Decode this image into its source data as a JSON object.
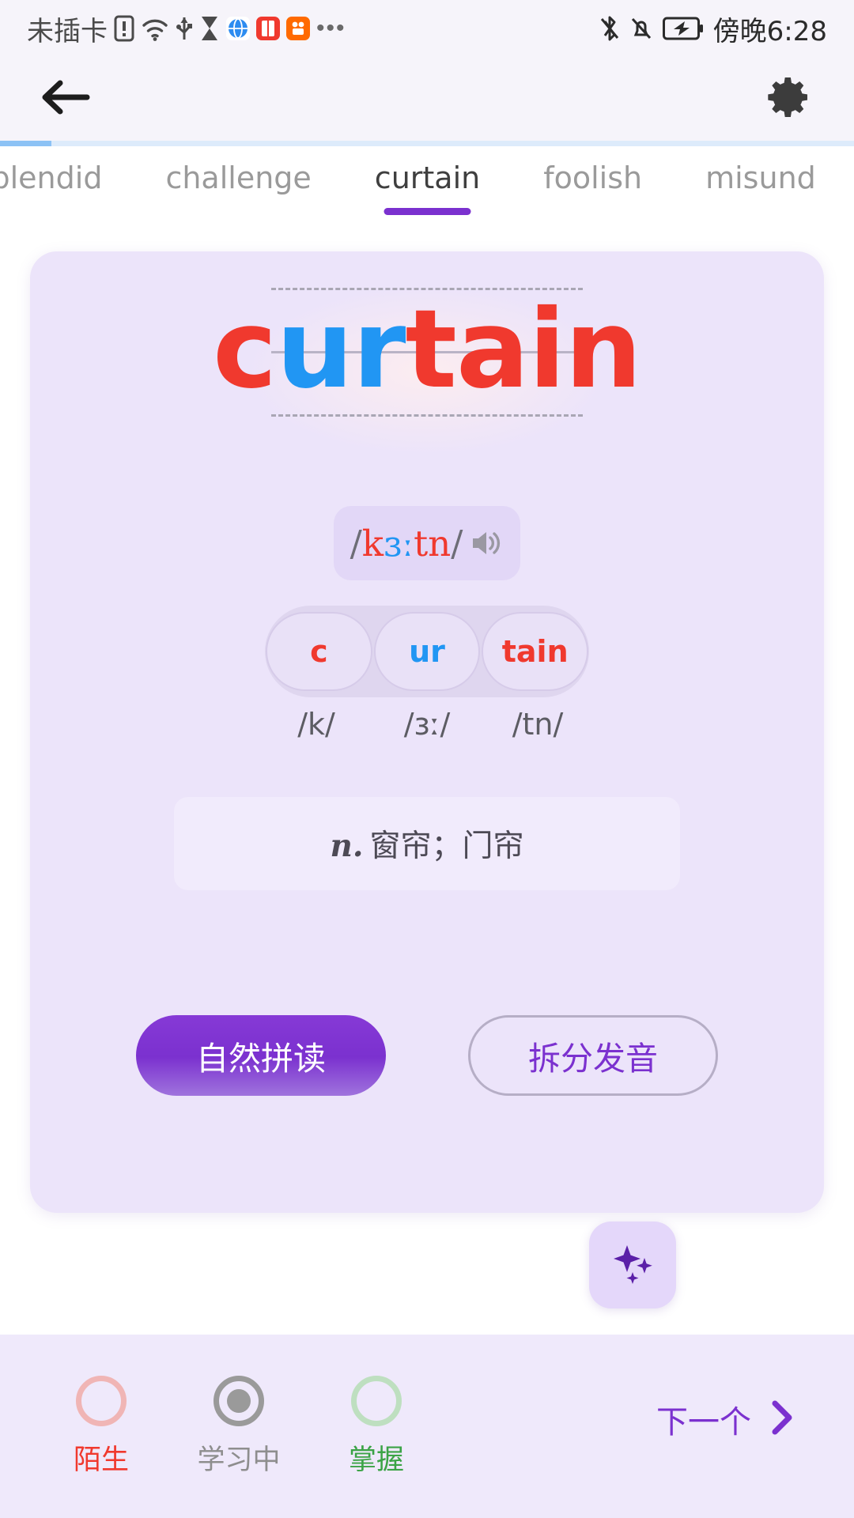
{
  "status_bar": {
    "carrier": "未插卡",
    "time": "傍晚6:28",
    "icons": [
      "sim-alert-icon",
      "wifi-icon",
      "usb-icon",
      "hourglass-icon",
      "globe-app-icon",
      "book-app-icon",
      "orange-app-icon",
      "more-dots-icon"
    ],
    "right_icons": [
      "bluetooth-icon",
      "notification-muted-icon",
      "battery-charging-icon"
    ]
  },
  "app_bar": {
    "back_icon": "arrow-left-icon",
    "settings_icon": "gear-icon"
  },
  "progress": {
    "percent": 6,
    "fill_color": "#8cc2f5",
    "track_color": "#ddebfb"
  },
  "tabs": {
    "active_index": 2,
    "items": [
      {
        "label": "plendid"
      },
      {
        "label": "challenge"
      },
      {
        "label": "curtain"
      },
      {
        "label": "foolish"
      },
      {
        "label": "misunders"
      }
    ]
  },
  "card": {
    "word": {
      "full": "curtain",
      "parts": [
        {
          "text": "c",
          "color": "#f0392e"
        },
        {
          "text": "ur",
          "color": "#2196f3"
        },
        {
          "text": "tain",
          "color": "#f0392e"
        }
      ]
    },
    "phonetic": {
      "open_slash": "/",
      "close_slash": "/",
      "parts": [
        {
          "text": "k",
          "color": "#f0392e"
        },
        {
          "text": "ɜː",
          "color": "#2196f3"
        },
        {
          "text": "tn",
          "color": "#f0392e"
        }
      ],
      "speaker_icon": "speaker-icon"
    },
    "syllables": [
      {
        "text": "c",
        "color_class": "red",
        "phoneme": "/k/"
      },
      {
        "text": "ur",
        "color_class": "blue",
        "phoneme": "/ɜː/"
      },
      {
        "text": "tain",
        "color_class": "red",
        "phoneme": "/tn/"
      }
    ],
    "definition": {
      "pos": "n.",
      "meaning": "窗帘；门帘"
    },
    "buttons": {
      "primary_label": "自然拼读",
      "outline_label": "拆分发音"
    }
  },
  "fab": {
    "icon": "sparkles-icon",
    "background": "#e4d7fa",
    "icon_color": "#5b1fa8"
  },
  "bottom_bar": {
    "statuses": [
      {
        "label": "陌生",
        "ring_class": "",
        "label_class": "lbl-red",
        "selected": false
      },
      {
        "label": "学习中",
        "ring_class": "gray",
        "label_class": "lbl-gray",
        "selected": true
      },
      {
        "label": "掌握",
        "ring_class": "green",
        "label_class": "lbl-green",
        "selected": false
      }
    ],
    "next_label": "下一个",
    "next_icon": "chevron-right-icon"
  }
}
